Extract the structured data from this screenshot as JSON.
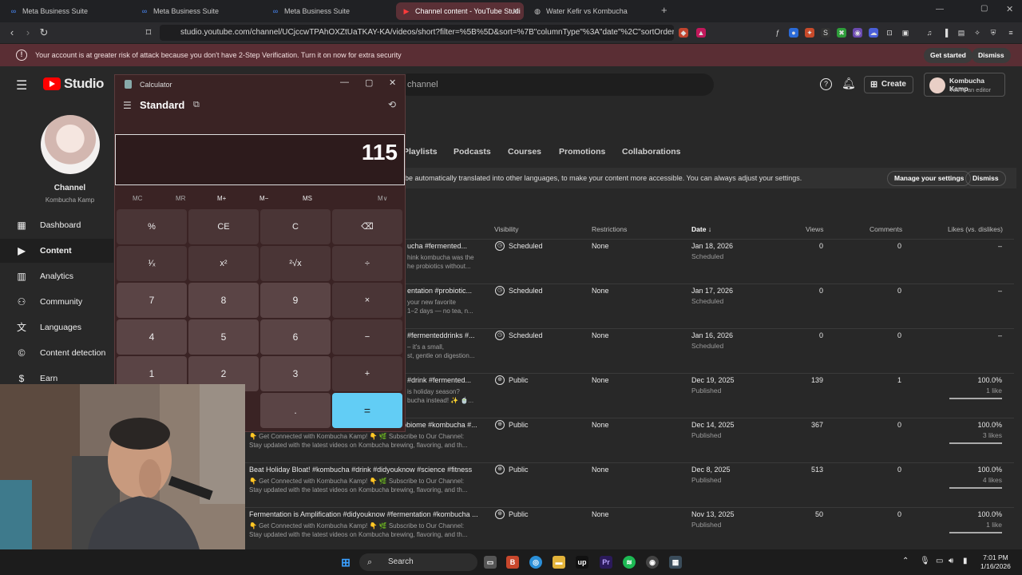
{
  "browser": {
    "tabs": [
      {
        "label": "Meta Business Suite"
      },
      {
        "label": "Meta Business Suite"
      },
      {
        "label": "Meta Business Suite"
      },
      {
        "label": "Channel content - YouTube Studi"
      },
      {
        "label": "Water Kefir vs Kombucha"
      }
    ],
    "url": "studio.youtube.com/channel/UCjccwTPAhOXZtUaTKAY-KA/videos/short?filter=%5B%5D&sort=%7B\"columnType\"%3A\"date\"%2C\"sortOrder\"..."
  },
  "banner": {
    "message": "Your account is at greater risk of attack because you don't have 2-Step Verification. Turn it on now for extra security",
    "get_started": "Get started",
    "dismiss": "Dismiss"
  },
  "studio": {
    "logo": "Studio",
    "search_placeholder": "channel",
    "create": "Create",
    "account_name": "Kombucha Kamp",
    "account_role": "You're an editor",
    "channel_label": "Channel",
    "channel_name": "Kombucha Kamp",
    "nav": [
      {
        "label": "Dashboard",
        "icon": "dashboard-icon"
      },
      {
        "label": "Content",
        "icon": "content-icon"
      },
      {
        "label": "Analytics",
        "icon": "analytics-icon"
      },
      {
        "label": "Community",
        "icon": "community-icon"
      },
      {
        "label": "Languages",
        "icon": "languages-icon"
      },
      {
        "label": "Content detection",
        "icon": "copyright-icon"
      },
      {
        "label": "Earn",
        "icon": "dollar-icon"
      }
    ],
    "tabs": [
      "Playlists",
      "Podcasts",
      "Courses",
      "Promotions",
      "Collaborations"
    ],
    "info_text": "be automatically translated into other languages, to make your content more accessible. You can always adjust your settings.",
    "manage_settings": "Manage your settings",
    "info_dismiss": "Dismiss",
    "columns": {
      "visibility": "Visibility",
      "restrictions": "Restrictions",
      "date": "Date",
      "views": "Views",
      "comments": "Comments",
      "likes": "Likes (vs. dislikes)"
    },
    "rows": [
      {
        "title": "ucha #fermented...",
        "desc1": "hink kombucha was the",
        "desc2": "he probiotics without...",
        "visibility": "Scheduled",
        "restrictions": "None",
        "date": "Jan 18, 2026",
        "status": "Scheduled",
        "views": "0",
        "comments": "0",
        "likes": "–",
        "likes_sub": ""
      },
      {
        "title": "entation #probiotic...",
        "desc1": "your new favorite",
        "desc2": "1–2 days — no tea, n...",
        "visibility": "Scheduled",
        "restrictions": "None",
        "date": "Jan 17, 2026",
        "status": "Scheduled",
        "views": "0",
        "comments": "0",
        "likes": "–",
        "likes_sub": ""
      },
      {
        "title": "#fermenteddrinks #...",
        "desc1": "– it's a small,",
        "desc2": "st, gentle on digestion...",
        "visibility": "Scheduled",
        "restrictions": "None",
        "date": "Jan 16, 2026",
        "status": "Scheduled",
        "views": "0",
        "comments": "0",
        "likes": "–",
        "likes_sub": ""
      },
      {
        "title": "#drink #fermented...",
        "desc1": "is holiday season?",
        "desc2": "bucha instead! ✨ 🍵...",
        "visibility": "Public",
        "restrictions": "None",
        "date": "Dec 19, 2025",
        "status": "Published",
        "views": "139",
        "comments": "1",
        "likes": "100.0%",
        "likes_sub": "1 like"
      },
      {
        "title": "Microbiome Boost! #didyouknow #science #microbiome #kombucha #...",
        "desc1": "👇 Get Connected with Kombucha Kamp! 👇 🌿 Subscribe to Our Channel:",
        "desc2": "Stay updated with the latest videos on Kombucha brewing, flavoring, and th...",
        "visibility": "Public",
        "restrictions": "None",
        "date": "Dec 14, 2025",
        "status": "Published",
        "views": "367",
        "comments": "0",
        "likes": "100.0%",
        "likes_sub": "3 likes"
      },
      {
        "title": "Beat Holiday Bloat! #kombucha #drink #didyouknow #science #fitness",
        "desc1": "👇 Get Connected with Kombucha Kamp! 👇 🌿 Subscribe to Our Channel:",
        "desc2": "Stay updated with the latest videos on Kombucha brewing, flavoring, and th...",
        "visibility": "Public",
        "restrictions": "None",
        "date": "Dec 8, 2025",
        "status": "Published",
        "views": "513",
        "comments": "0",
        "likes": "100.0%",
        "likes_sub": "4 likes"
      },
      {
        "title": "Fermentation is Amplification #didyouknow #fermentation #kombucha ...",
        "desc1": "👇 Get Connected with Kombucha Kamp! 👇 🌿 Subscribe to Our Channel:",
        "desc2": "Stay updated with the latest videos on Kombucha brewing, flavoring, and th...",
        "visibility": "Public",
        "restrictions": "None",
        "date": "Nov 13, 2025",
        "status": "Published",
        "views": "50",
        "comments": "0",
        "likes": "100.0%",
        "likes_sub": "1 like"
      }
    ]
  },
  "calculator": {
    "title": "Calculator",
    "mode": "Standard",
    "display": "115",
    "memory": [
      "MC",
      "MR",
      "M+",
      "M−",
      "MS",
      "M∨"
    ],
    "keys": [
      [
        "%",
        "CE",
        "C",
        "⌫"
      ],
      [
        "¹⁄ₓ",
        "x²",
        "²√x",
        "÷"
      ],
      [
        "7",
        "8",
        "9",
        "×"
      ],
      [
        "4",
        "5",
        "6",
        "−"
      ],
      [
        "1",
        "2",
        "3",
        "+"
      ],
      [
        "",
        "",
        ".",
        "="
      ]
    ]
  },
  "taskbar": {
    "search": "Search",
    "time": "7:01 PM",
    "date": "1/16/2026"
  },
  "colors": {
    "accent": "#62cdf5",
    "banner": "#5a2e34",
    "youtube_red": "#ff0000"
  }
}
